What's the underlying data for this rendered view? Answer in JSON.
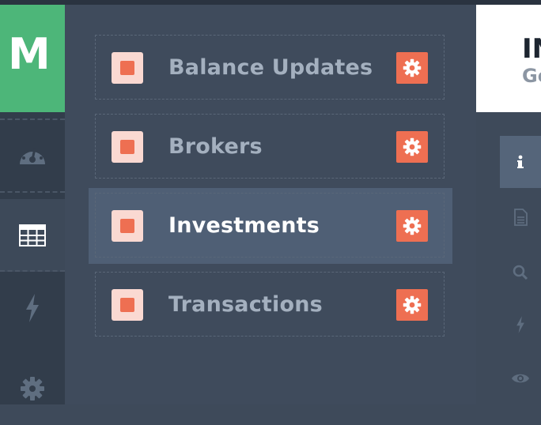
{
  "app": {
    "logo_letter": "M"
  },
  "rail": {
    "items": [
      {
        "name": "dashboard",
        "icon": "dashboard-gauge-icon"
      },
      {
        "name": "tables",
        "icon": "table-grid-icon",
        "active": true
      },
      {
        "name": "actions",
        "icon": "lightning-icon"
      },
      {
        "name": "settings",
        "icon": "gear-icon"
      }
    ]
  },
  "list": {
    "items": [
      {
        "label": "Balance Updates"
      },
      {
        "label": "Brokers"
      },
      {
        "label": "Investments",
        "selected": true
      },
      {
        "label": "Transactions"
      }
    ]
  },
  "detail": {
    "title": "IN",
    "subtitle": "Ge",
    "tabs": [
      {
        "icon": "info-icon",
        "active": true
      },
      {
        "icon": "document-icon"
      },
      {
        "icon": "search-icon"
      },
      {
        "icon": "lightning-icon"
      },
      {
        "icon": "eye-icon"
      }
    ]
  },
  "colors": {
    "accent": "#ee6f52",
    "brand": "#4db679",
    "panel": "#3f4b5c",
    "selected": "#4f5f75"
  }
}
